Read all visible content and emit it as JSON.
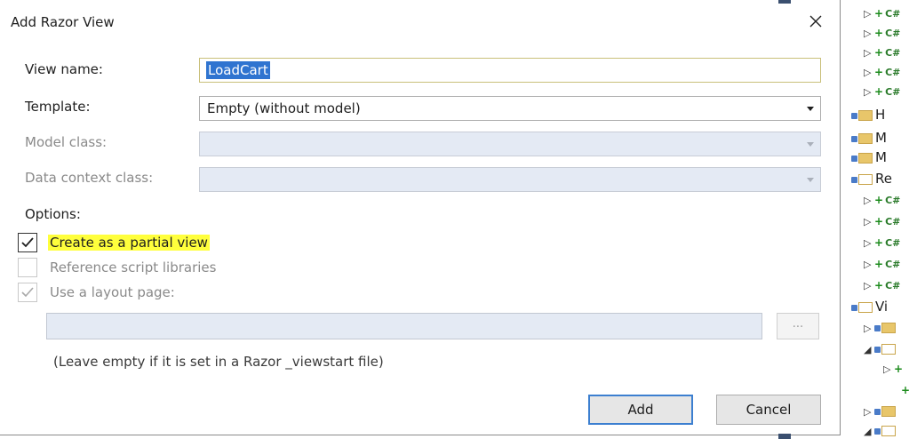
{
  "dialog": {
    "title": "Add Razor View",
    "close_glyph": "×",
    "view_name_label": "View name:",
    "view_name_value": "LoadCart",
    "template_label": "Template:",
    "template_value": "Empty (without model)",
    "model_class_label": "Model class:",
    "data_context_label": "Data context class:",
    "options_label": "Options:",
    "options": [
      {
        "label": "Create as a partial view",
        "checked": true,
        "enabled": true
      },
      {
        "label": "Reference script libraries",
        "checked": false,
        "enabled": false
      },
      {
        "label": "Use a layout page:",
        "checked": true,
        "enabled": false
      }
    ],
    "browse_label": "...",
    "hint": "(Leave empty if it is set in a Razor _viewstart file)",
    "add_label": "Add",
    "cancel_label": "Cancel"
  },
  "explorer": {
    "rows": [
      {
        "kind": "cs",
        "text": "C#"
      },
      {
        "kind": "cs",
        "text": "C#"
      },
      {
        "kind": "cs",
        "text": "C#"
      },
      {
        "kind": "cs",
        "text": "C#"
      },
      {
        "kind": "cs",
        "text": "C#"
      },
      {
        "kind": "folder",
        "text": "H"
      },
      {
        "kind": "folder",
        "text": "M"
      },
      {
        "kind": "folder",
        "text": "M"
      },
      {
        "kind": "folder-open",
        "text": "Re"
      },
      {
        "kind": "cs",
        "text": "C#"
      },
      {
        "kind": "cs",
        "text": "C#"
      },
      {
        "kind": "cs",
        "text": "C#"
      },
      {
        "kind": "cs",
        "text": "C#"
      },
      {
        "kind": "cs",
        "text": "C#"
      },
      {
        "kind": "folder-open",
        "text": "Vi"
      }
    ]
  },
  "colors": {
    "selection": "#2f74d0",
    "highlight": "#ffff3c",
    "default_button_border": "#3c7fd0"
  }
}
